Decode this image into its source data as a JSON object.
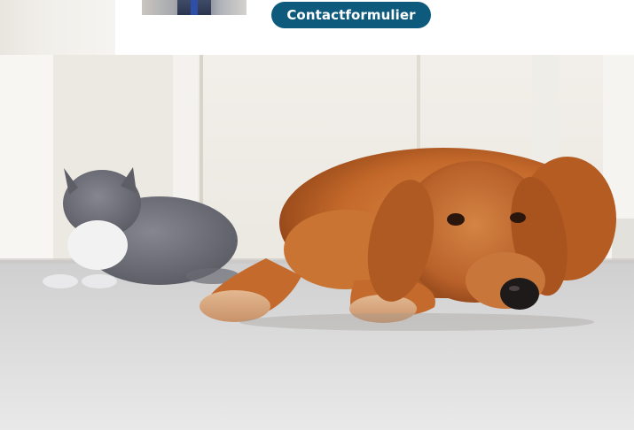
{
  "header": {
    "contact_button_label": "Contactformulier",
    "avatar_icon": "person-photo"
  },
  "hero_image": {
    "subject": "pets-image",
    "accent_colors": {
      "button": "#0d5a7c",
      "dog_fur": "#c46a2c",
      "cat_fur": "#6e6f78",
      "floor": "#dcdcdc"
    }
  }
}
